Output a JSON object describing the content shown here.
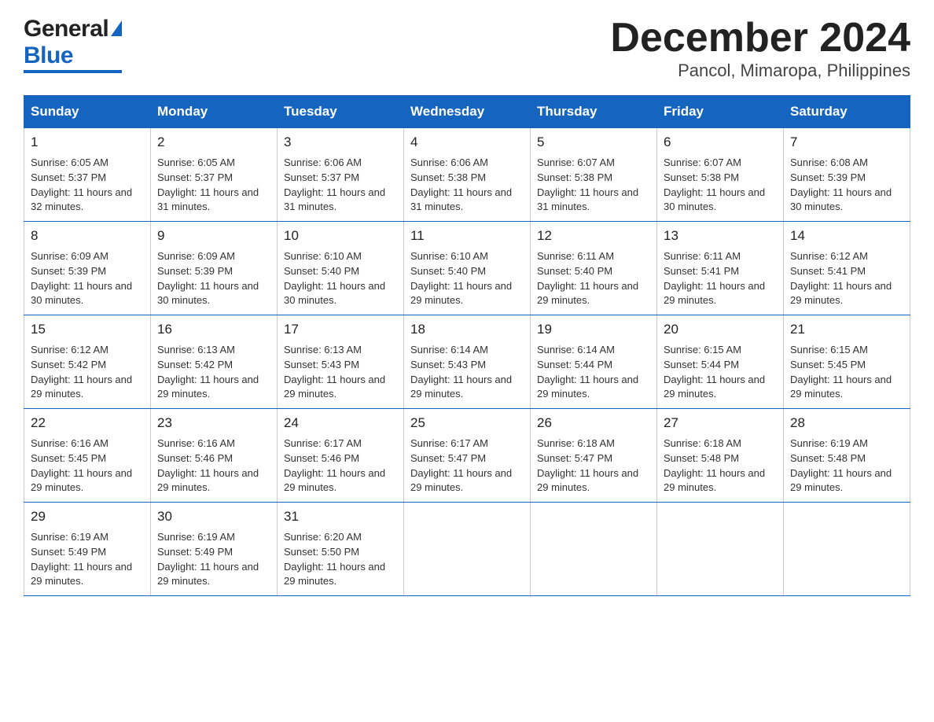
{
  "header": {
    "logo_general": "General",
    "logo_blue": "Blue",
    "title": "December 2024",
    "subtitle": "Pancol, Mimaropa, Philippines"
  },
  "days_of_week": [
    "Sunday",
    "Monday",
    "Tuesday",
    "Wednesday",
    "Thursday",
    "Friday",
    "Saturday"
  ],
  "weeks": [
    [
      {
        "day": "1",
        "sunrise": "6:05 AM",
        "sunset": "5:37 PM",
        "daylight": "11 hours and 32 minutes."
      },
      {
        "day": "2",
        "sunrise": "6:05 AM",
        "sunset": "5:37 PM",
        "daylight": "11 hours and 31 minutes."
      },
      {
        "day": "3",
        "sunrise": "6:06 AM",
        "sunset": "5:37 PM",
        "daylight": "11 hours and 31 minutes."
      },
      {
        "day": "4",
        "sunrise": "6:06 AM",
        "sunset": "5:38 PM",
        "daylight": "11 hours and 31 minutes."
      },
      {
        "day": "5",
        "sunrise": "6:07 AM",
        "sunset": "5:38 PM",
        "daylight": "11 hours and 31 minutes."
      },
      {
        "day": "6",
        "sunrise": "6:07 AM",
        "sunset": "5:38 PM",
        "daylight": "11 hours and 30 minutes."
      },
      {
        "day": "7",
        "sunrise": "6:08 AM",
        "sunset": "5:39 PM",
        "daylight": "11 hours and 30 minutes."
      }
    ],
    [
      {
        "day": "8",
        "sunrise": "6:09 AM",
        "sunset": "5:39 PM",
        "daylight": "11 hours and 30 minutes."
      },
      {
        "day": "9",
        "sunrise": "6:09 AM",
        "sunset": "5:39 PM",
        "daylight": "11 hours and 30 minutes."
      },
      {
        "day": "10",
        "sunrise": "6:10 AM",
        "sunset": "5:40 PM",
        "daylight": "11 hours and 30 minutes."
      },
      {
        "day": "11",
        "sunrise": "6:10 AM",
        "sunset": "5:40 PM",
        "daylight": "11 hours and 29 minutes."
      },
      {
        "day": "12",
        "sunrise": "6:11 AM",
        "sunset": "5:40 PM",
        "daylight": "11 hours and 29 minutes."
      },
      {
        "day": "13",
        "sunrise": "6:11 AM",
        "sunset": "5:41 PM",
        "daylight": "11 hours and 29 minutes."
      },
      {
        "day": "14",
        "sunrise": "6:12 AM",
        "sunset": "5:41 PM",
        "daylight": "11 hours and 29 minutes."
      }
    ],
    [
      {
        "day": "15",
        "sunrise": "6:12 AM",
        "sunset": "5:42 PM",
        "daylight": "11 hours and 29 minutes."
      },
      {
        "day": "16",
        "sunrise": "6:13 AM",
        "sunset": "5:42 PM",
        "daylight": "11 hours and 29 minutes."
      },
      {
        "day": "17",
        "sunrise": "6:13 AM",
        "sunset": "5:43 PM",
        "daylight": "11 hours and 29 minutes."
      },
      {
        "day": "18",
        "sunrise": "6:14 AM",
        "sunset": "5:43 PM",
        "daylight": "11 hours and 29 minutes."
      },
      {
        "day": "19",
        "sunrise": "6:14 AM",
        "sunset": "5:44 PM",
        "daylight": "11 hours and 29 minutes."
      },
      {
        "day": "20",
        "sunrise": "6:15 AM",
        "sunset": "5:44 PM",
        "daylight": "11 hours and 29 minutes."
      },
      {
        "day": "21",
        "sunrise": "6:15 AM",
        "sunset": "5:45 PM",
        "daylight": "11 hours and 29 minutes."
      }
    ],
    [
      {
        "day": "22",
        "sunrise": "6:16 AM",
        "sunset": "5:45 PM",
        "daylight": "11 hours and 29 minutes."
      },
      {
        "day": "23",
        "sunrise": "6:16 AM",
        "sunset": "5:46 PM",
        "daylight": "11 hours and 29 minutes."
      },
      {
        "day": "24",
        "sunrise": "6:17 AM",
        "sunset": "5:46 PM",
        "daylight": "11 hours and 29 minutes."
      },
      {
        "day": "25",
        "sunrise": "6:17 AM",
        "sunset": "5:47 PM",
        "daylight": "11 hours and 29 minutes."
      },
      {
        "day": "26",
        "sunrise": "6:18 AM",
        "sunset": "5:47 PM",
        "daylight": "11 hours and 29 minutes."
      },
      {
        "day": "27",
        "sunrise": "6:18 AM",
        "sunset": "5:48 PM",
        "daylight": "11 hours and 29 minutes."
      },
      {
        "day": "28",
        "sunrise": "6:19 AM",
        "sunset": "5:48 PM",
        "daylight": "11 hours and 29 minutes."
      }
    ],
    [
      {
        "day": "29",
        "sunrise": "6:19 AM",
        "sunset": "5:49 PM",
        "daylight": "11 hours and 29 minutes."
      },
      {
        "day": "30",
        "sunrise": "6:19 AM",
        "sunset": "5:49 PM",
        "daylight": "11 hours and 29 minutes."
      },
      {
        "day": "31",
        "sunrise": "6:20 AM",
        "sunset": "5:50 PM",
        "daylight": "11 hours and 29 minutes."
      },
      null,
      null,
      null,
      null
    ]
  ],
  "labels": {
    "sunrise": "Sunrise:",
    "sunset": "Sunset:",
    "daylight": "Daylight:"
  }
}
